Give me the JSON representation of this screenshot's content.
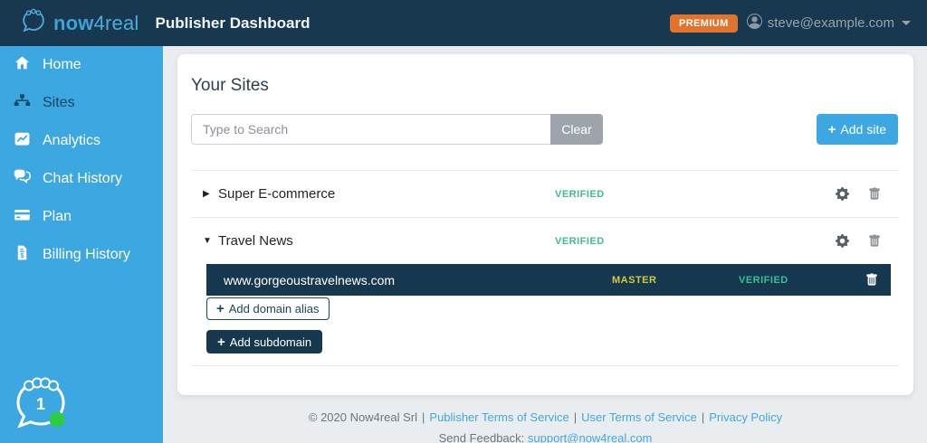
{
  "navbar": {
    "logo_now": "now",
    "logo_4real": "4real",
    "title": "Publisher Dashboard",
    "premium_badge": "PREMIUM",
    "user_email": "steve@example.com"
  },
  "sidebar": {
    "items": [
      {
        "label": "Home",
        "icon": "home-icon",
        "active": false
      },
      {
        "label": "Sites",
        "icon": "sitemap-icon",
        "active": true
      },
      {
        "label": "Analytics",
        "icon": "analytics-icon",
        "active": false
      },
      {
        "label": "Chat History",
        "icon": "chat-icon",
        "active": false
      },
      {
        "label": "Plan",
        "icon": "credit-card-icon",
        "active": false
      },
      {
        "label": "Billing History",
        "icon": "billing-icon",
        "active": false
      }
    ],
    "chat_widget": {
      "unread_count": "1"
    }
  },
  "main": {
    "heading": "Your Sites",
    "search": {
      "placeholder": "Type to Search",
      "value": ""
    },
    "clear_button": "Clear",
    "add_site_button": "Add site",
    "sites": [
      {
        "name": "Super E-commerce",
        "status": "VERIFIED",
        "expanded": false
      },
      {
        "name": "Travel News",
        "status": "VERIFIED",
        "expanded": true
      }
    ],
    "domain_row": {
      "domain": "www.gorgeoustravelnews.com",
      "role": "MASTER",
      "status": "VERIFIED"
    },
    "add_domain_alias_button": "Add domain alias",
    "add_subdomain_button": "Add subdomain"
  },
  "footer": {
    "copyright": "© 2020 Now4real Srl",
    "separator": "|",
    "links": {
      "publisher_tos": "Publisher Terms of Service",
      "user_tos": "User Terms of Service",
      "privacy": "Privacy Policy"
    },
    "feedback_label": "Send Feedback:",
    "feedback_email": "support@now4real.com"
  },
  "icons": {
    "caret_right": "▶",
    "caret_down": "▼",
    "plus": "+"
  },
  "colors": {
    "navbar_bg": "#17384E",
    "sidebar_bg": "#3CA7E0",
    "active_item": "#17465E",
    "premium_orange": "#E0742C",
    "verified_green": "#41BD8A",
    "master_yellow": "#D5C93B",
    "dark_row_bg": "#16384F",
    "link_blue": "#41A7E0",
    "add_site_blue": "#3CA7E0",
    "online_dot_green": "#2BCC44"
  }
}
